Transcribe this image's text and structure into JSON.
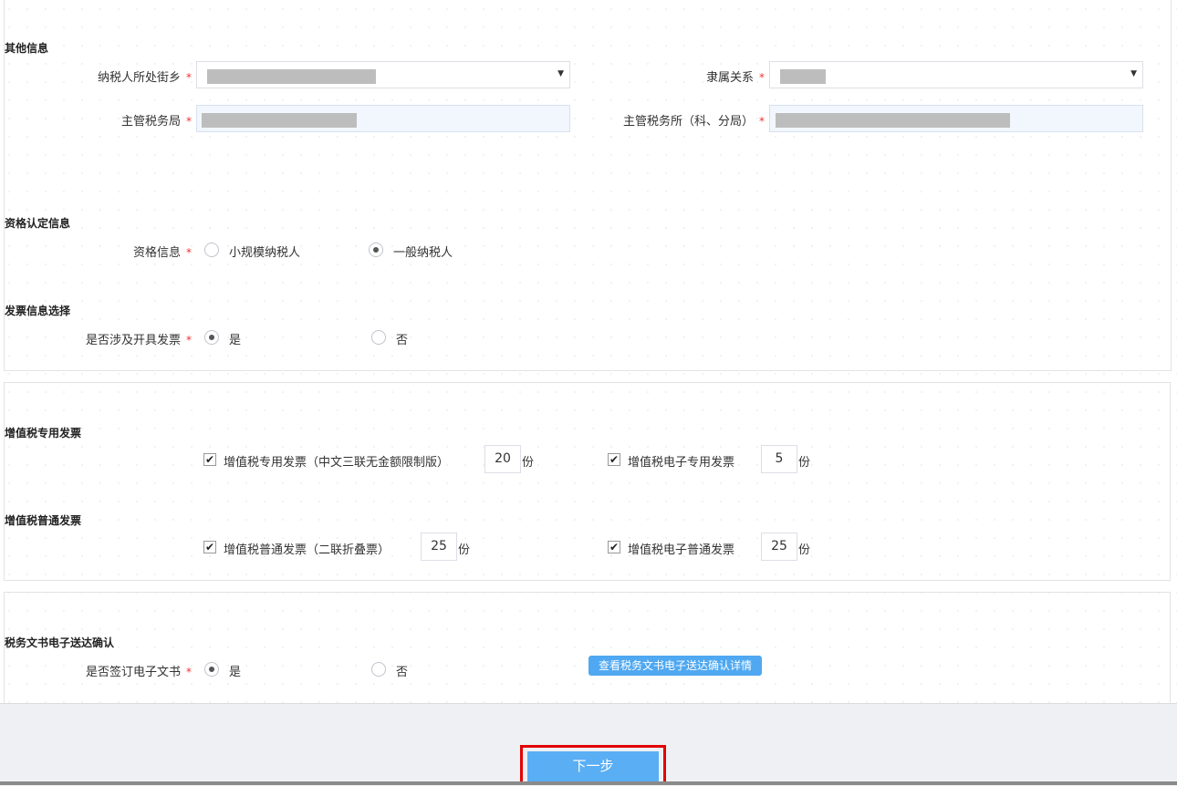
{
  "other_info": {
    "title": "其他信息",
    "street_label": "纳税人所处街乡",
    "affiliation_label": "隶属关系",
    "tax_bureau_label": "主管税务局",
    "tax_office_label": "主管税务所（科、分局）",
    "required_mark": "*",
    "dropdown_caret": "▼"
  },
  "qualification": {
    "title": "资格认定信息",
    "label": "资格信息",
    "options": [
      "小规模纳税人",
      "一般纳税人"
    ],
    "selected": "一般纳税人"
  },
  "invoice_choice": {
    "title": "发票信息选择",
    "label": "是否涉及开具发票",
    "options": [
      "是",
      "否"
    ],
    "selected": "是"
  },
  "vat_special": {
    "title": "增值税专用发票",
    "items": [
      {
        "label": "增值税专用发票（中文三联无金额限制版）",
        "checked": true,
        "qty": "20",
        "unit": "份"
      },
      {
        "label": "增值税电子专用发票",
        "checked": true,
        "qty": "5",
        "unit": "份"
      }
    ]
  },
  "vat_general": {
    "title": "增值税普通发票",
    "items": [
      {
        "label": "增值税普通发票（二联折叠票）",
        "checked": true,
        "qty": "25",
        "unit": "份"
      },
      {
        "label": "增值税电子普通发票",
        "checked": true,
        "qty": "25",
        "unit": "份"
      }
    ]
  },
  "e_doc": {
    "title": "税务文书电子送达确认",
    "label": "是否签订电子文书",
    "options": [
      "是",
      "否"
    ],
    "selected": "是",
    "detail_button": "查看税务文书电子送达确认详情"
  },
  "footer": {
    "next_button": "下一步"
  },
  "colors": {
    "accent": "#5aaef4",
    "required": "#ee3333",
    "highlight_border": "#e20000"
  },
  "icons": {
    "check": "✔"
  }
}
